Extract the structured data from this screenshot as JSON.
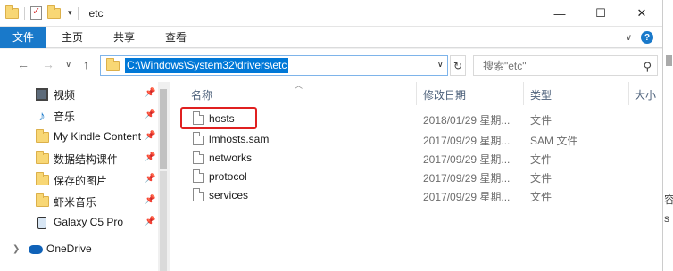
{
  "window": {
    "title": "etc",
    "minimize": "—",
    "maximize": "☐",
    "close": "✕"
  },
  "ribbon": {
    "tabs": [
      "文件",
      "主页",
      "共享",
      "查看"
    ],
    "expand_icon": "chevron-down-icon",
    "help_label": "?"
  },
  "navigation": {
    "back": "←",
    "forward": "→",
    "recent": "∨",
    "up": "↑",
    "address": "C:\\Windows\\System32\\drivers\\etc",
    "refresh": "↻",
    "search_placeholder": "搜索\"etc\"",
    "accent": "#0078d7"
  },
  "sidebar": {
    "items": [
      {
        "label": "视频",
        "icon": "video-icon",
        "pinned": true
      },
      {
        "label": "音乐",
        "icon": "music-icon",
        "pinned": true
      },
      {
        "label": "My Kindle Content",
        "icon": "folder-icon",
        "pinned": true
      },
      {
        "label": "数据结构课件",
        "icon": "folder-icon",
        "pinned": true
      },
      {
        "label": "保存的图片",
        "icon": "folder-icon",
        "pinned": true
      },
      {
        "label": "虾米音乐",
        "icon": "folder-icon",
        "pinned": true
      },
      {
        "label": "Galaxy C5 Pro",
        "icon": "phone-icon",
        "pinned": true
      }
    ],
    "onedrive": "OneDrive"
  },
  "columns": {
    "name": "名称",
    "date": "修改日期",
    "type": "类型",
    "size": "大小"
  },
  "files": [
    {
      "name": "hosts",
      "date": "2018/01/29 星期...",
      "type": "文件",
      "highlighted": true
    },
    {
      "name": "lmhosts.sam",
      "date": "2017/09/29 星期...",
      "type": "SAM 文件"
    },
    {
      "name": "networks",
      "date": "2017/09/29 星期...",
      "type": "文件"
    },
    {
      "name": "protocol",
      "date": "2017/09/29 星期...",
      "type": "文件"
    },
    {
      "name": "services",
      "date": "2017/09/29 星期...",
      "type": "文件"
    }
  ],
  "highlight_color": "#e02020",
  "edge_peek": [
    "容",
    "s"
  ]
}
